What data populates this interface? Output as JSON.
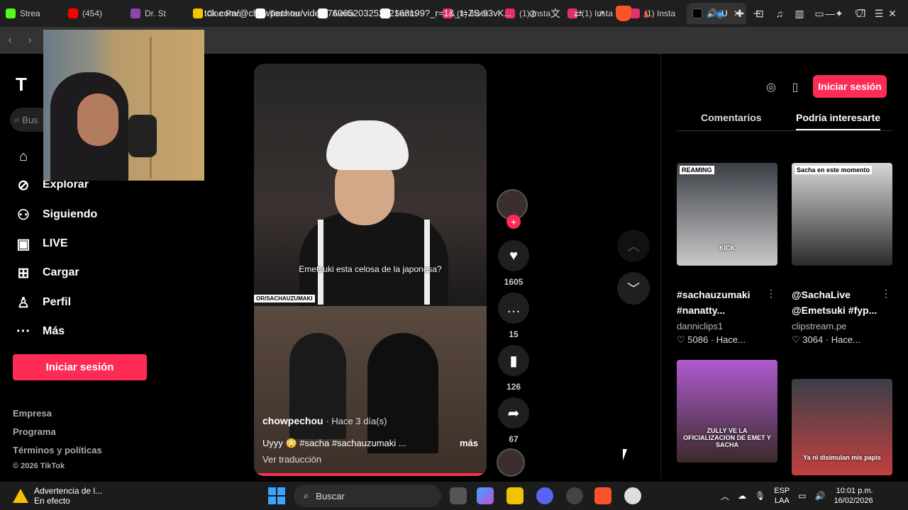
{
  "browser": {
    "tabs": [
      {
        "label": "Strea",
        "color": "#53fc18"
      },
      {
        "label": "(454)",
        "color": "#ff0000"
      },
      {
        "label": "Dr. St",
        "color": "#8e44ad"
      },
      {
        "label": "One Pac",
        "color": "#f5c400"
      },
      {
        "label": "Todo ter",
        "color": "#ffffff"
      },
      {
        "label": "Alerta",
        "color": "#ffffff"
      },
      {
        "label": "Santo",
        "color": "#ffffff"
      },
      {
        "label": "(1) Insta",
        "color": "#e1306c"
      },
      {
        "label": "(1) Insta",
        "color": "#e1306c"
      },
      {
        "label": "(1) Insta",
        "color": "#e1306c"
      },
      {
        "label": "(1) Insta",
        "color": "#e1306c"
      }
    ],
    "active_tab_label": "U",
    "url": "tok.com/@chowpechou/video/7606520325232168199?_r=1&_t=ZS-93vK...",
    "new_tab_symbol": "+"
  },
  "sidebar": {
    "logo": "T",
    "search_placeholder": "Bus",
    "items": [
      {
        "label": "",
        "icon": "home-icon",
        "glyph": "⌂"
      },
      {
        "label": "Explorar",
        "icon": "compass-icon",
        "glyph": "⊘"
      },
      {
        "label": "Siguiendo",
        "icon": "following-icon",
        "glyph": "⚇"
      },
      {
        "label": "LIVE",
        "icon": "live-icon",
        "glyph": "▣"
      },
      {
        "label": "Cargar",
        "icon": "upload-icon",
        "glyph": "⊞"
      },
      {
        "label": "Perfil",
        "icon": "profile-icon",
        "glyph": "♙"
      },
      {
        "label": "Más",
        "icon": "more-icon",
        "glyph": "···"
      }
    ],
    "login_label": "Iniciar sesión",
    "footer": [
      "Empresa",
      "Programa",
      "Términos y políticas",
      "© 2026 TikTok"
    ]
  },
  "video": {
    "caption": "Emetsuki esta celosa de la japonesa?",
    "watermark": "OR/SACHAUZUMAKI",
    "author": "chowpechou",
    "ago": "· Hace 3 día(s)",
    "description": "Uyyy 😳 #sacha #sachauzumaki ...",
    "more": "más",
    "translate": "Ver traducción",
    "likes": "1605",
    "comments": "15",
    "saves": "126",
    "shares": "67"
  },
  "right_panel": {
    "login_label": "Iniciar sesión",
    "tab_comments": "Comentarios",
    "tab_suggested": "Podría interesarte",
    "cards": [
      {
        "title": "#sachauzumaki #nanatty...",
        "user": "danniclips1",
        "likes": "5086",
        "ago": "Hace...",
        "thumb_colors": [
          "#3b3f46",
          "#c9c9c9"
        ],
        "overlay": "KICK",
        "top_text": "REAMING"
      },
      {
        "title": "@SachaLive @Emetsuki #fyp...",
        "user": "clipstream.pe",
        "likes": "3064",
        "ago": "Hace...",
        "thumb_colors": [
          "#d8d8d8",
          "#2a2a2a"
        ],
        "overlay": "",
        "top_text": "Sacha en este momento"
      },
      {
        "title": "",
        "user": "",
        "likes": "",
        "ago": "",
        "thumb_colors": [
          "#b05bd0",
          "#3a2a2a"
        ],
        "overlay": "ZULLY VE LA OFICIALIZACION DE EMET Y SACHA",
        "top_text": ""
      },
      {
        "title": "",
        "user": "",
        "likes": "",
        "ago": "",
        "thumb_colors": [
          "#3a3f48",
          "#c24040"
        ],
        "overlay": "Ya ni disimulan mis papis",
        "top_text": ""
      }
    ]
  },
  "taskbar": {
    "warning_title": "Advertencia de l...",
    "warning_sub": "En efecto",
    "search_label": "Buscar",
    "lang_1": "ESP",
    "lang_2": "LAA",
    "time": "10:01 p.m.",
    "date": "16/02/2026"
  }
}
